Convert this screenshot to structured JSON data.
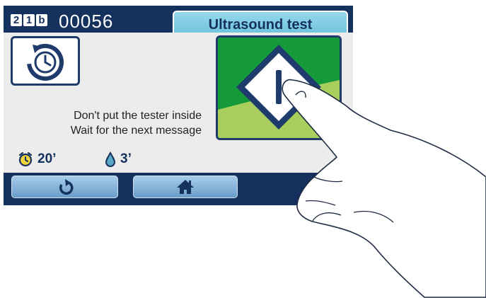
{
  "header": {
    "cycle_badge": [
      "2",
      "1",
      "b"
    ],
    "cycle_counter": "00056",
    "title": "Ultrasound test"
  },
  "main": {
    "message_line1": "Don't put the tester inside",
    "message_line2": "Wait for the next message",
    "duration_value": "20’",
    "water_value": "3’"
  },
  "icons": {
    "program": "cycle-clock-icon",
    "start": "start-diamond-icon",
    "duration": "alarm-clock-icon",
    "water": "water-drop-icon",
    "back": "back-arrow-icon",
    "home": "home-icon"
  },
  "colors": {
    "screen_frame": "#15315e",
    "title_bg": "#7ccbe1",
    "start_green": "#14a03c",
    "clock_yellow": "#f2d23a",
    "button_blue": "#7faed6"
  }
}
